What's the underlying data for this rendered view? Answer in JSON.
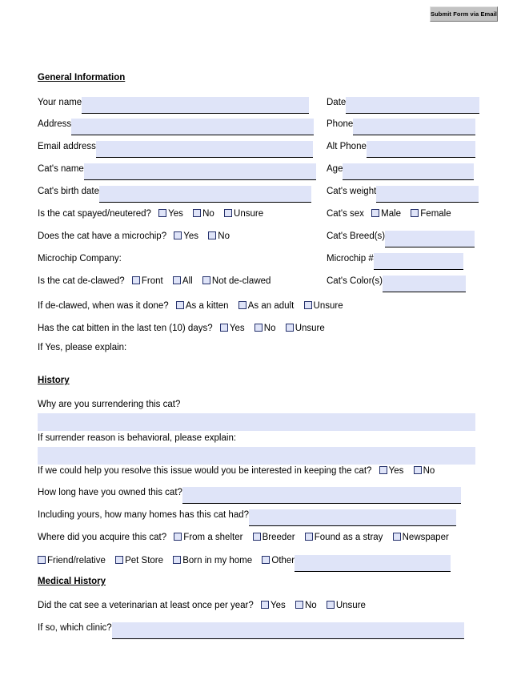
{
  "toolbar": {
    "submit_label": "Submit Form via Email"
  },
  "sections": {
    "general": "General Information",
    "history": "History",
    "medical": "Medical History"
  },
  "general": {
    "your_name": "Your name",
    "address": "Address",
    "email_address": "Email address",
    "cats_name": "Cat's name",
    "cats_birth_date": "Cat's birth date",
    "date": "Date",
    "phone": "Phone",
    "alt_phone": "Alt Phone",
    "age": "Age",
    "cats_weight": "Cat's weight",
    "spayed_q": "Is the cat spayed/neutered?",
    "spayed_yes": "Yes",
    "spayed_no": "No",
    "spayed_unsure": "Unsure",
    "microchip_q": "Does the cat have a microchip?",
    "microchip_yes": "Yes",
    "microchip_no": "No",
    "microchip_company": "Microchip Company:",
    "declawed_q": "Is the cat de-clawed?",
    "declawed_front": "Front",
    "declawed_all": "All",
    "declawed_not": "Not de-clawed",
    "cats_sex": "Cat's sex",
    "sex_male": "Male",
    "sex_female": "Female",
    "cats_breeds": "Cat's Breed(s)",
    "microchip_num": "Microchip #",
    "cats_colors": "Cat's Color(s)",
    "declawed_when_q": "If de-clawed, when was it done?",
    "when_kitten": "As a kitten",
    "when_adult": "As an adult",
    "when_unsure": "Unsure",
    "bitten_q": "Has the cat bitten in the last ten (10) days?",
    "bitten_yes": "Yes",
    "bitten_no": "No",
    "bitten_unsure": "Unsure",
    "if_yes_explain": "If Yes, please explain:"
  },
  "history": {
    "why_surrender": "Why are you surrendering this cat?",
    "behavioral_explain": "If surrender reason is behavioral, please explain:",
    "resolve_q": "If we could help you resolve this issue would you be interested in keeping the cat?",
    "resolve_yes": "Yes",
    "resolve_no": "No",
    "how_long_owned": "How long have you owned this cat?",
    "how_many_homes": "Including yours, how many homes has this cat had?",
    "acquire_q": "Where did you acquire this cat?",
    "acq_shelter": "From a shelter",
    "acq_breeder": "Breeder",
    "acq_stray": "Found as a stray",
    "acq_newspaper": "Newspaper",
    "acq_friend": "Friend/relative",
    "acq_petstore": "Pet Store",
    "acq_born": "Born in my home",
    "acq_other": "Other"
  },
  "medical": {
    "vet_q": "Did the cat see a veterinarian at least once per year?",
    "vet_yes": "Yes",
    "vet_no": "No",
    "vet_unsure": "Unsure",
    "which_clinic": "If so, which clinic?"
  },
  "colors": {
    "field_fill": "#dfe4f8",
    "checkbox_border": "#24306b",
    "button_face": "#c3c3c3",
    "text": "#000000"
  }
}
